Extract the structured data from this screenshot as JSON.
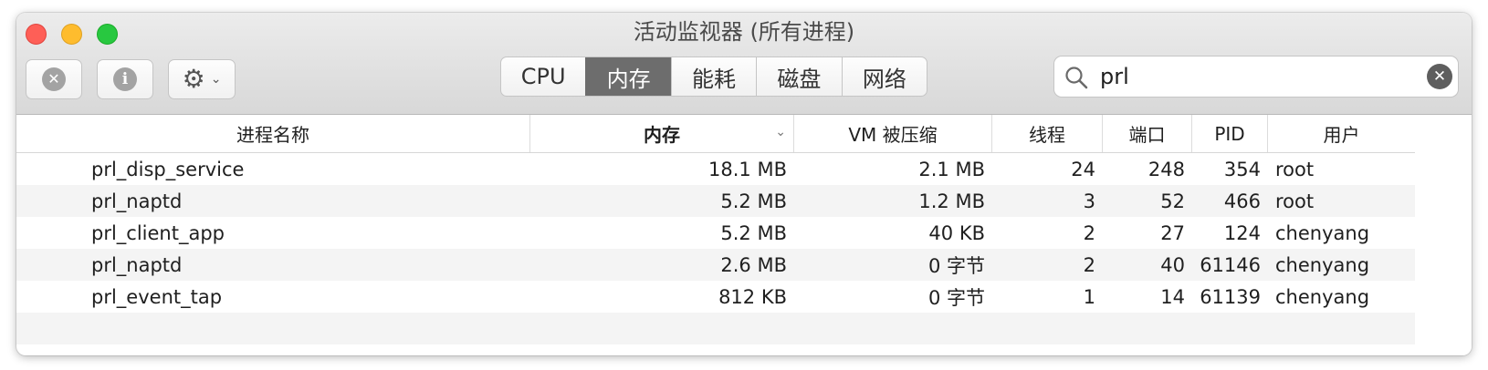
{
  "window": {
    "title": "活动监视器 (所有进程)"
  },
  "toolbar": {
    "stop_icon": "x-circle-icon",
    "info_icon": "info-circle-icon",
    "gear_icon": "gear-icon",
    "stop_glyph": "✕",
    "info_glyph": "i",
    "gear_glyph": "⚙",
    "chevron_glyph": "⌄",
    "tabs": [
      {
        "label": "CPU",
        "active": false
      },
      {
        "label": "内存",
        "active": true
      },
      {
        "label": "能耗",
        "active": false
      },
      {
        "label": "磁盘",
        "active": false
      },
      {
        "label": "网络",
        "active": false
      }
    ],
    "search": {
      "value": "prl",
      "clear_glyph": "✕"
    }
  },
  "table": {
    "columns": [
      "进程名称",
      "内存",
      "VM 被压缩",
      "线程",
      "端口",
      "PID",
      "用户"
    ],
    "sort_glyph": "⌄",
    "rows": [
      {
        "name": "prl_disp_service",
        "memory": "18.1 MB",
        "vm": "2.1 MB",
        "threads": "24",
        "ports": "248",
        "pid": "354",
        "user": "root"
      },
      {
        "name": "prl_naptd",
        "memory": "5.2 MB",
        "vm": "1.2 MB",
        "threads": "3",
        "ports": "52",
        "pid": "466",
        "user": "root"
      },
      {
        "name": "prl_client_app",
        "memory": "5.2 MB",
        "vm": "40 KB",
        "threads": "2",
        "ports": "27",
        "pid": "124",
        "user": "chenyang"
      },
      {
        "name": "prl_naptd",
        "memory": "2.6 MB",
        "vm": "0 字节",
        "threads": "2",
        "ports": "40",
        "pid": "61146",
        "user": "chenyang"
      },
      {
        "name": "prl_event_tap",
        "memory": "812 KB",
        "vm": "0 字节",
        "threads": "1",
        "ports": "14",
        "pid": "61139",
        "user": "chenyang"
      }
    ]
  },
  "colors": {
    "active_tab": "#6d6d6d",
    "close": "#fe5f57",
    "minimize": "#febc2e",
    "zoom": "#28c840"
  }
}
